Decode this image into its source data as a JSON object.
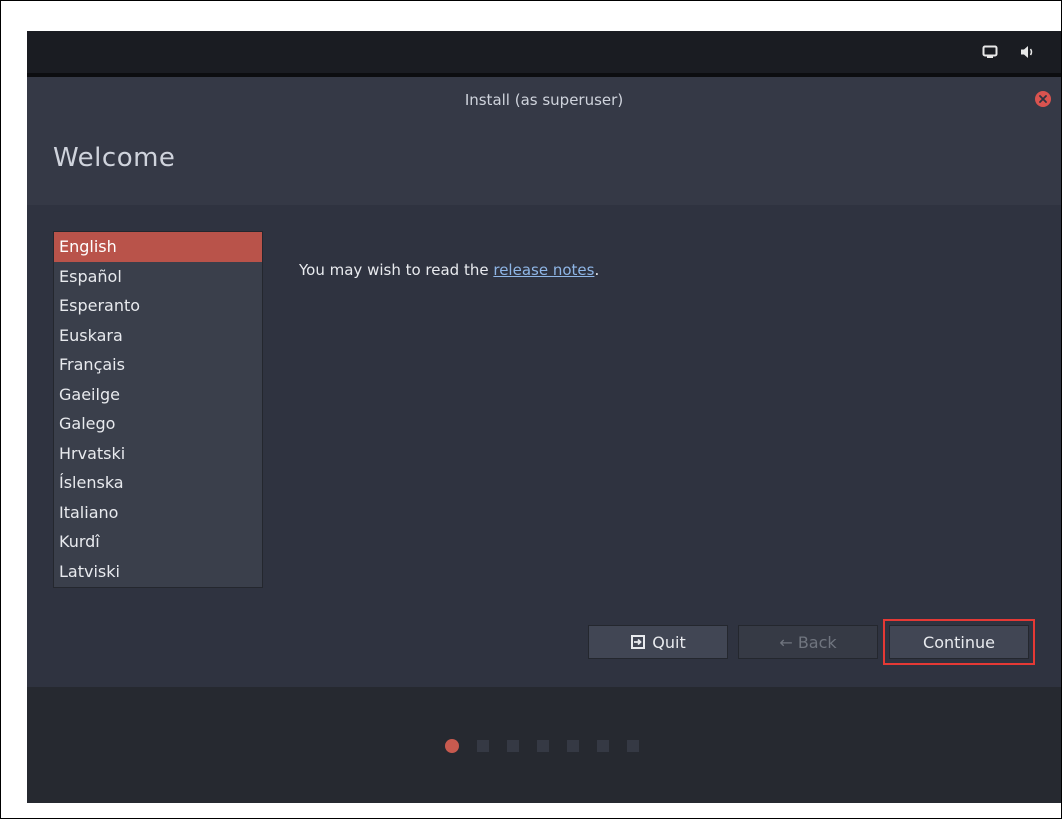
{
  "window": {
    "title": "Install (as superuser)"
  },
  "page": {
    "heading": "Welcome"
  },
  "tray": {
    "icons": [
      "screen-icon",
      "volume-icon"
    ]
  },
  "languages": {
    "selected": "English",
    "items": [
      "English",
      "Español",
      "Esperanto",
      "Euskara",
      "Français",
      "Gaeilge",
      "Galego",
      "Hrvatski",
      "Íslenska",
      "Italiano",
      "Kurdî",
      "Latviski"
    ]
  },
  "release": {
    "prefix": "You may wish to read the ",
    "link_text": "release notes",
    "suffix": "."
  },
  "buttons": {
    "quit": "Quit",
    "back": "← Back",
    "continue": "Continue"
  },
  "progress": {
    "total_steps": 7,
    "current_step": 1
  },
  "colors": {
    "accent": "#b9534a",
    "link": "#8fb6e6",
    "highlight": "#e53935"
  }
}
